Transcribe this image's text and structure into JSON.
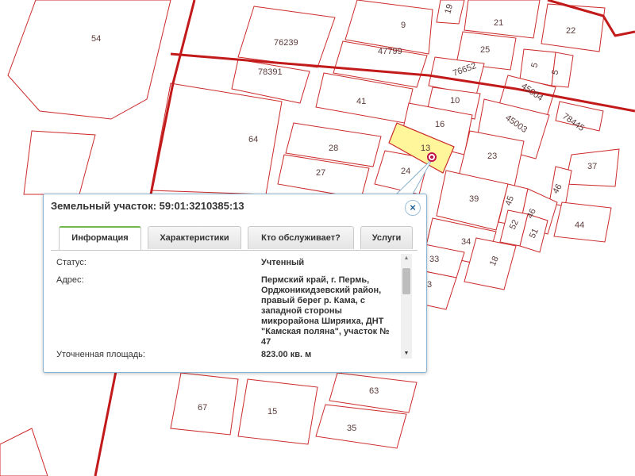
{
  "map": {
    "colors": {
      "parcel_stroke": "#cc2a2a",
      "boundary": "#c21a1a",
      "selected_fill": "#fff59a",
      "marker": "#c0104a"
    },
    "parcel_labels": [
      "54",
      "76239",
      "9",
      "19",
      "21",
      "22",
      "25",
      "47799",
      "78391",
      "5",
      "5",
      "76652",
      "45004",
      "10",
      "41",
      "78445",
      "45003",
      "16",
      "64",
      "13",
      "28",
      "23",
      "37",
      "24",
      "27",
      "46",
      "39",
      "45",
      "46",
      "44",
      "52",
      "51",
      "34",
      "33",
      "18",
      "3",
      "67",
      "15",
      "63",
      "35"
    ],
    "selected_parcel": "13"
  },
  "popup": {
    "title": "Земельный участок: 59:01:3210385:13",
    "close_icon": "×",
    "tabs": [
      "Информация",
      "Характеристики",
      "Кто обслуживает?",
      "Услуги"
    ],
    "active_tab": "Информация",
    "fields": [
      {
        "label": "Статус:",
        "value": "Учтенный"
      },
      {
        "label": "Адрес:",
        "value": "Пермский край, г. Пермь, Орджоникидзевский район, правый берег р. Кама, с западной стороны микрорайона Ширяиха, ДНТ \"Камская поляна\", участок № 47"
      },
      {
        "label": "Уточненная площадь:",
        "value": "823.00 кв. м"
      }
    ],
    "scroll_up_icon": "▲",
    "scroll_down_icon": "▼"
  }
}
